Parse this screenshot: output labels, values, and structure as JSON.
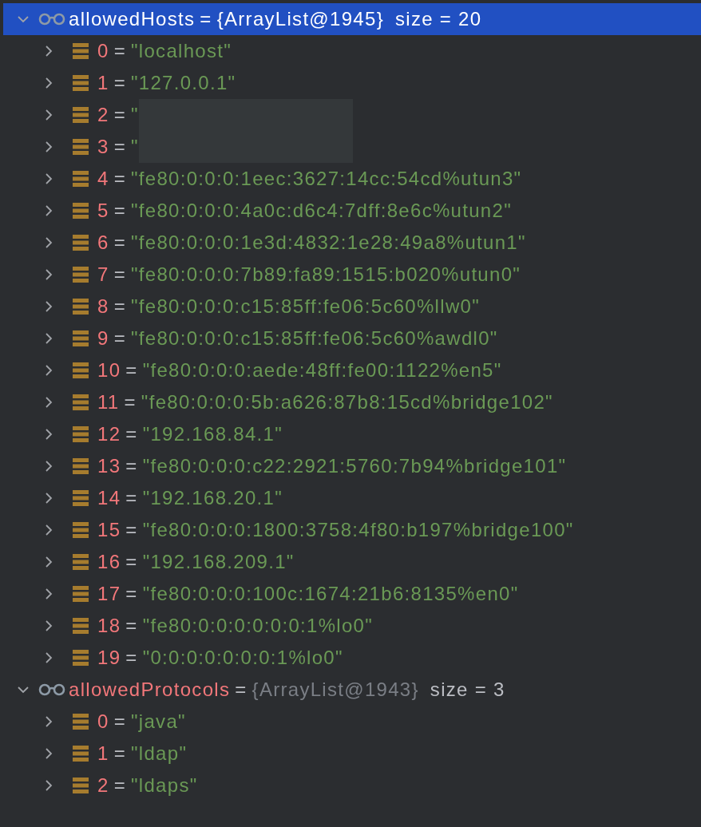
{
  "variables": [
    {
      "name": "allowedHosts",
      "separator": "=",
      "type": "{ArrayList@1945}",
      "size": "size = 20",
      "expanded": true,
      "selected": true,
      "items": [
        {
          "index": "0",
          "separator": "=",
          "value": "\"localhost\"",
          "redacted": false
        },
        {
          "index": "1",
          "separator": "=",
          "value": "\"127.0.0.1\"",
          "redacted": false
        },
        {
          "index": "2",
          "separator": "=",
          "value": "\"",
          "redacted": true
        },
        {
          "index": "3",
          "separator": "=",
          "value": "\"",
          "redacted": true
        },
        {
          "index": "4",
          "separator": "=",
          "value": "\"fe80:0:0:0:1eec:3627:14cc:54cd%utun3\"",
          "redacted": false
        },
        {
          "index": "5",
          "separator": "=",
          "value": "\"fe80:0:0:0:4a0c:d6c4:7dff:8e6c%utun2\"",
          "redacted": false
        },
        {
          "index": "6",
          "separator": "=",
          "value": "\"fe80:0:0:0:1e3d:4832:1e28:49a8%utun1\"",
          "redacted": false
        },
        {
          "index": "7",
          "separator": "=",
          "value": "\"fe80:0:0:0:7b89:fa89:1515:b020%utun0\"",
          "redacted": false
        },
        {
          "index": "8",
          "separator": "=",
          "value": "\"fe80:0:0:0:c15:85ff:fe06:5c60%llw0\"",
          "redacted": false
        },
        {
          "index": "9",
          "separator": "=",
          "value": "\"fe80:0:0:0:c15:85ff:fe06:5c60%awdl0\"",
          "redacted": false
        },
        {
          "index": "10",
          "separator": "=",
          "value": "\"fe80:0:0:0:aede:48ff:fe00:1122%en5\"",
          "redacted": false
        },
        {
          "index": "11",
          "separator": "=",
          "value": "\"fe80:0:0:0:5b:a626:87b8:15cd%bridge102\"",
          "redacted": false
        },
        {
          "index": "12",
          "separator": "=",
          "value": "\"192.168.84.1\"",
          "redacted": false
        },
        {
          "index": "13",
          "separator": "=",
          "value": "\"fe80:0:0:0:c22:2921:5760:7b94%bridge101\"",
          "redacted": false
        },
        {
          "index": "14",
          "separator": "=",
          "value": "\"192.168.20.1\"",
          "redacted": false
        },
        {
          "index": "15",
          "separator": "=",
          "value": "\"fe80:0:0:0:1800:3758:4f80:b197%bridge100\"",
          "redacted": false
        },
        {
          "index": "16",
          "separator": "=",
          "value": "\"192.168.209.1\"",
          "redacted": false
        },
        {
          "index": "17",
          "separator": "=",
          "value": "\"fe80:0:0:0:100c:1674:21b6:8135%en0\"",
          "redacted": false
        },
        {
          "index": "18",
          "separator": "=",
          "value": "\"fe80:0:0:0:0:0:0:1%lo0\"",
          "redacted": false
        },
        {
          "index": "19",
          "separator": "=",
          "value": "\"0:0:0:0:0:0:0:1%lo0\"",
          "redacted": false
        }
      ]
    },
    {
      "name": "allowedProtocols",
      "separator": "=",
      "type": "{ArrayList@1943}",
      "size": "size = 3",
      "expanded": true,
      "selected": false,
      "items": [
        {
          "index": "0",
          "separator": "=",
          "value": "\"java\"",
          "redacted": false
        },
        {
          "index": "1",
          "separator": "=",
          "value": "\"ldap\"",
          "redacted": false
        },
        {
          "index": "2",
          "separator": "=",
          "value": "\"ldaps\"",
          "redacted": false
        }
      ]
    }
  ]
}
